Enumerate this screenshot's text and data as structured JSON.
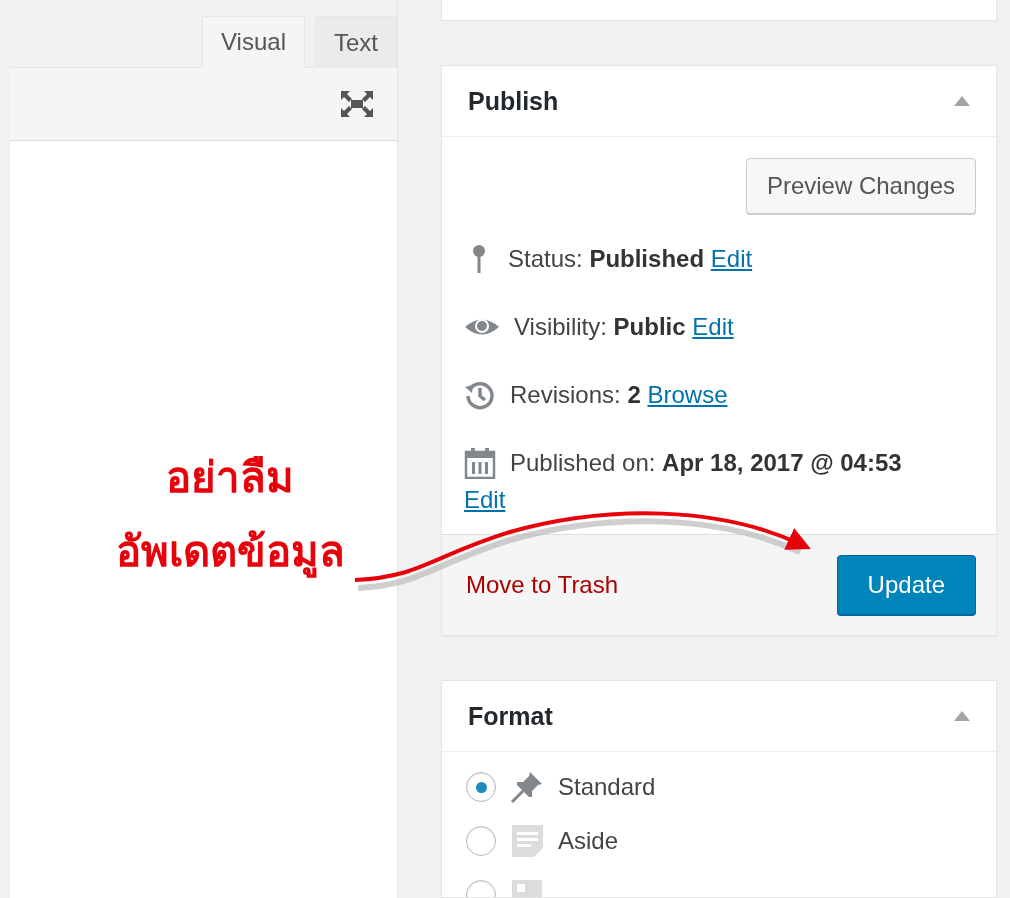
{
  "editor": {
    "tabs": [
      {
        "label": "Visual",
        "selected": true
      },
      {
        "label": "Text",
        "selected": false
      }
    ]
  },
  "publish": {
    "title": "Publish",
    "preview_button": "Preview Changes",
    "rows": [
      {
        "kind": "status",
        "label": "Status:",
        "value": "Published",
        "link": "Edit"
      },
      {
        "kind": "visibility",
        "label": "Visibility:",
        "value": "Public",
        "link": "Edit"
      },
      {
        "kind": "revisions",
        "label": "Revisions:",
        "value": "2",
        "link": "Browse"
      },
      {
        "kind": "date",
        "label": "Published on:",
        "value": "Apr 18, 2017 @ 04:53",
        "link": "Edit"
      }
    ],
    "trash_link": "Move to Trash",
    "update_button": "Update"
  },
  "format": {
    "title": "Format",
    "options": [
      {
        "kind": "standard",
        "label": "Standard",
        "selected": true
      },
      {
        "kind": "aside",
        "label": "Aside",
        "selected": false
      },
      {
        "kind": "image",
        "selected": false
      }
    ]
  },
  "annotation": {
    "lines": [
      "อย่าลืม",
      "อัพเดตข้อมูล"
    ]
  }
}
